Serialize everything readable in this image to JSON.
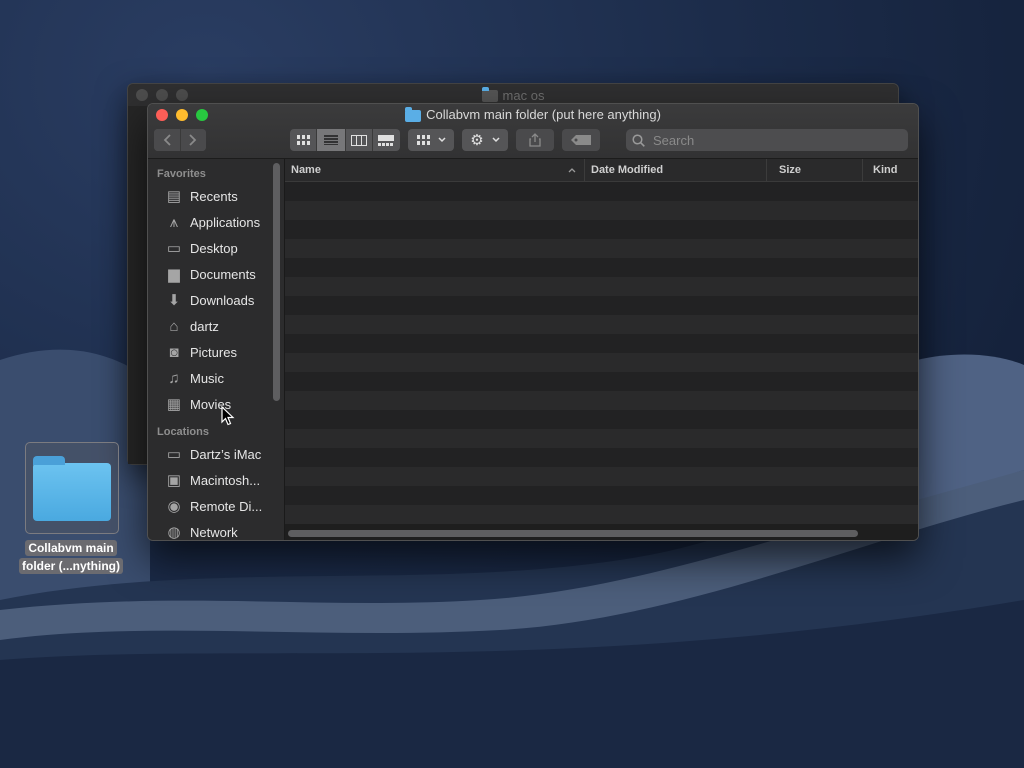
{
  "desktop": {
    "icon_label_line1": "Collabvm main",
    "icon_label_line2": "folder (...nything)"
  },
  "back_window": {
    "title": "mac os"
  },
  "window": {
    "title": "Collabvm main folder (put here anything)",
    "search_placeholder": "Search"
  },
  "sidebar": {
    "favorites_header": "Favorites",
    "favorites": [
      {
        "label": "Recents",
        "icon": "recents-icon"
      },
      {
        "label": "Applications",
        "icon": "applications-icon"
      },
      {
        "label": "Desktop",
        "icon": "desktop-icon"
      },
      {
        "label": "Documents",
        "icon": "documents-icon"
      },
      {
        "label": "Downloads",
        "icon": "downloads-icon"
      },
      {
        "label": "dartz",
        "icon": "home-icon"
      },
      {
        "label": "Pictures",
        "icon": "pictures-icon"
      },
      {
        "label": "Music",
        "icon": "music-icon"
      },
      {
        "label": "Movies",
        "icon": "movies-icon"
      }
    ],
    "locations_header": "Locations",
    "locations": [
      {
        "label": "Dartz’s iMac",
        "icon": "imac-icon"
      },
      {
        "label": "Macintosh...",
        "icon": "disk-icon"
      },
      {
        "label": "Remote Di...",
        "icon": "remote-disc-icon"
      },
      {
        "label": "Network",
        "icon": "network-icon"
      }
    ]
  },
  "list": {
    "columns": [
      "Name",
      "Date Modified",
      "Size",
      "Kind"
    ],
    "sort_column": "Name",
    "sort_direction": "ascending"
  }
}
